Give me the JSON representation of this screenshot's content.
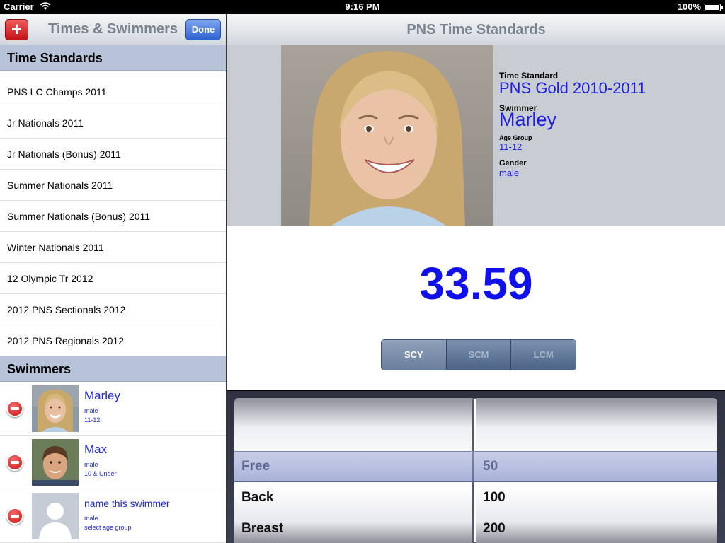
{
  "status_bar": {
    "carrier": "Carrier",
    "time": "9:16 PM",
    "battery": "100%"
  },
  "master": {
    "title": "Times & Swimmers",
    "add_label": "+",
    "done_label": "Done",
    "standards_header": "Time Standards",
    "standards": [
      "PNS LC Champs 2011",
      "Jr Nationals 2011",
      "Jr Nationals (Bonus) 2011",
      "Summer Nationals 2011",
      "Summer Nationals (Bonus) 2011",
      "Winter Nationals 2011",
      "12 Olympic Tr 2012",
      "2012 PNS Sectionals 2012",
      "2012 PNS Regionals 2012"
    ],
    "swimmers_header": "Swimmers",
    "swimmers": [
      {
        "name": "Marley",
        "gender": "male",
        "age_group": "11-12"
      },
      {
        "name": "Max",
        "gender": "male",
        "age_group": "10 & Under"
      },
      {
        "name": "name this swimmer",
        "gender": "male",
        "age_group": "select age group"
      }
    ]
  },
  "detail": {
    "title": "PNS Time Standards",
    "time_standard_label": "Time Standard",
    "time_standard": "PNS Gold 2010-2011",
    "swimmer_label": "Swimmer",
    "swimmer": "Marley",
    "age_group_label": "Age Group",
    "age_group": "11-12",
    "gender_label": "Gender",
    "gender": "male",
    "time": "33.59",
    "course_options": [
      "SCY",
      "SCM",
      "LCM"
    ],
    "selected_course": "SCY"
  },
  "picker": {
    "strokes": [
      "Free",
      "Back",
      "Breast"
    ],
    "distances": [
      "50",
      "100",
      "200"
    ],
    "selected_stroke": "Free",
    "selected_distance": "50"
  }
}
